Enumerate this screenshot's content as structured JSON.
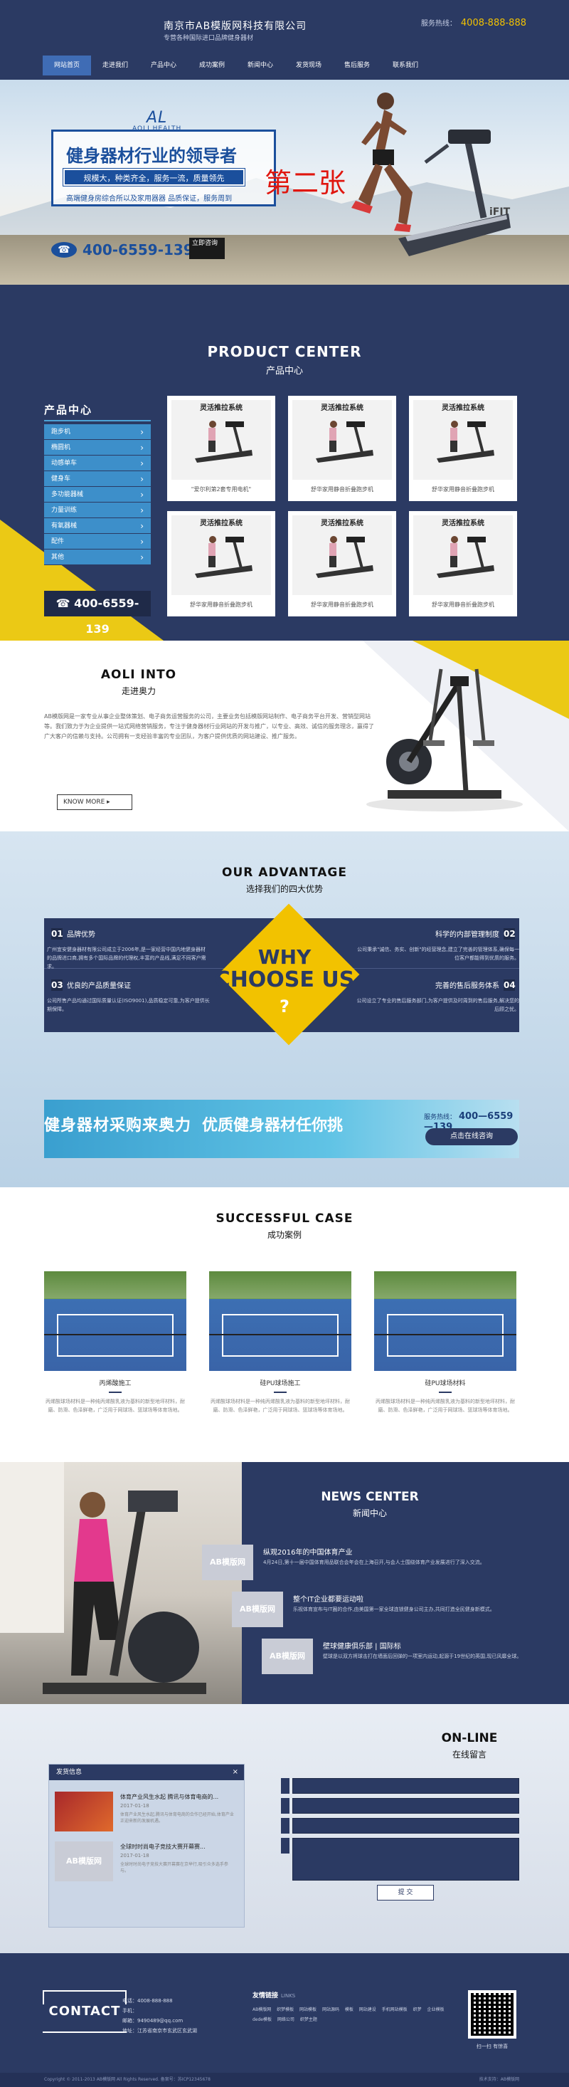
{
  "header": {
    "company": "南京市AB模版网科技有限公司",
    "slogan": "专营各种国际进口品牌健身器材",
    "hotline_label": "服务热线：",
    "hotline": "4008-888-888",
    "nav": [
      "网站首页",
      "走进我们",
      "产品中心",
      "成功案例",
      "新闻中心",
      "发货现场",
      "售后服务",
      "联系我们"
    ]
  },
  "banner": {
    "brand_mark": "AL",
    "brand_name": "AOLI HEALTH",
    "title": "健身器材行业的领导者",
    "tagline": "规模大，种类齐全，服务一流，质量领先",
    "desc": "高端健身房综合所以及家用器器 品质保证，服务周到",
    "second": "第二张",
    "phone": "400-6559-139",
    "consult": "立即咨询",
    "ifit": "iFIT"
  },
  "products": {
    "title_en": "PRODUCT CENTER",
    "title_cn": "产品中心",
    "menu_head": "产品中心",
    "menu": [
      "跑步机",
      "椭圆机",
      "动感单车",
      "健身车",
      "多功能器械",
      "力量训练",
      "有氧器械",
      "配件",
      "其他"
    ],
    "phone": "400-6559-139",
    "items": [
      {
        "title": "灵活推拉系统",
        "caption": "\"爱尔利第2套专用电机\""
      },
      {
        "title": "灵活推拉系统",
        "caption": "舒华家用静音折叠跑步机"
      },
      {
        "title": "灵活推拉系统",
        "caption": "舒华家用静音折叠跑步机"
      },
      {
        "title": "灵活推拉系统",
        "caption": "舒华家用静音折叠跑步机"
      },
      {
        "title": "灵活推拉系统",
        "caption": "舒华家用静音折叠跑步机"
      },
      {
        "title": "灵活推拉系统",
        "caption": "舒华家用静音折叠跑步机"
      }
    ]
  },
  "about": {
    "title_en": "AOLI INTO",
    "title_cn": "走进奥力",
    "text": "AB模版网是一家专业从事企业整体策划、电子商务运营服务的公司，主要业务包括模版网站制作、电子商务平台开发、营销型网站等。我们致力于为企业提供一站式网络营销服务，专注于健身器材行业网站的开发与推广，以专业、高效、诚信的服务理念，赢得了广大客户的信赖与支持。公司拥有一支经验丰富的专业团队，为客户提供优质的网站建设、推广服务。",
    "more": "KNOW MORE"
  },
  "advantage": {
    "title_en": "OUR ADVANTAGE",
    "title_cn": "选择我们的四大优势",
    "items": [
      {
        "no": "01",
        "title": "品牌优势",
        "desc": "广州宜安健身器材有限公司成立于2006年,是一家经营中国内地健身器材的品牌进口商,拥有多个国际品牌的代理权,丰富的产品线,满足不同客户需求。"
      },
      {
        "no": "02",
        "title": "科学的内部管理制度",
        "desc": "公司秉承\"诚信、务实、创新\"的经营理念,建立了完善的管理体系,确保每一位客户都能得到优质的服务。"
      },
      {
        "no": "03",
        "title": "优良的产品质量保证",
        "desc": "公司所售产品均通过国际质量认证(ISO9001),品质稳定可靠,为客户提供长期保障。"
      },
      {
        "no": "04",
        "title": "完善的售后服务体系",
        "desc": "公司设立了专业的售后服务部门,为客户提供及时周到的售后服务,解决您的后顾之忧。"
      }
    ],
    "why1": "WHY",
    "why2": "CHOOSE US",
    "why3": "?",
    "ad_slogan": "健身器材采购来奥力",
    "ad_slogan2": "优质健身器材任你挑",
    "ad_phone_label": "服务热线：",
    "ad_phone": "400—6559—139",
    "ad_button": "点击在线咨询"
  },
  "cases": {
    "title_en": "SUCCESSFUL CASE",
    "title_cn": "成功案例",
    "items": [
      {
        "title": "丙烯酸施工",
        "desc": "丙烯酸球场材料是一种纯丙烯酸乳液为基料的新型地坪材料，耐磨、防滑、色泽鲜艳，广泛用于网球场、篮球场等体育场地。"
      },
      {
        "title": "硅PU球场施工",
        "desc": "丙烯酸球场材料是一种纯丙烯酸乳液为基料的新型地坪材料，耐磨、防滑、色泽鲜艳，广泛用于网球场、篮球场等体育场地。"
      },
      {
        "title": "硅PU球场材料",
        "desc": "丙烯酸球场材料是一种纯丙烯酸乳液为基料的新型地坪材料，耐磨、防滑、色泽鲜艳，广泛用于网球场、篮球场等体育场地。"
      }
    ]
  },
  "news": {
    "title_en": "NEWS CENTER",
    "title_cn": "新闻中心",
    "logo_text": "AB模版网",
    "items": [
      {
        "title": "纵观2016年的中国体育产业",
        "desc": "4月24日,第十一届中国体育用品联合会年会在上海召开,与会人士围绕体育产业发展进行了深入交流。"
      },
      {
        "title": "整个IT企业都要运动啦",
        "desc": "乐视体育宣布与IT圈的合作,由美国第一家全球连锁健身公司主办,共同打造全民健身新模式。"
      },
      {
        "title": "壁球健康俱乐部 | 国际标",
        "desc": "壁球是以双方将球击打在墙面后回弹的一项室内运动,起源于19世纪的英国,现已风靡全球。"
      }
    ]
  },
  "online": {
    "title_en": "ON-LINE",
    "title_cn": "在线留言",
    "box_title": "发货信息",
    "items": [
      {
        "title": "体育产业风生水起 腾讯与体育电商的...",
        "date": "2017-01-18",
        "desc": "体育产业风生水起,腾讯与体育电商的合作已经开始,体育产业正迎来新的发展机遇。"
      },
      {
        "title": "全球时时尚电子竞技大赛开幕赛...",
        "date": "2017-01-18",
        "desc": "全球时时尚电子竞技大赛开幕赛在京举行,吸引众多选手参与。"
      }
    ],
    "submit": "提 交"
  },
  "footer": {
    "contact": "CONTACT",
    "phone": "电话：4008-888-888",
    "mobile": "手机：",
    "email": "邮箱：9490489@qq.com",
    "address": "地址：江苏省南京市玄武区玄武湖",
    "links_title": "友情链接",
    "links_en": "LINKS",
    "links": "AB模版网 织梦模板 网站模板 网站源码 模板 网站建设 手机网站模板 织梦 企业模板 dede模板 网络公司 织梦主题",
    "qr_caption": "扫一扫 有惊喜",
    "copyright": "Copyright © 2011-2013 AB模版网 All Rights Reserved. 备案号：苏ICP12345678",
    "tech": "技术支持：AB模版网"
  },
  "colors": {
    "navy": "#2b3a63",
    "yellow": "#ebc915",
    "blue": "#3d8fca",
    "red": "#e0160e"
  }
}
